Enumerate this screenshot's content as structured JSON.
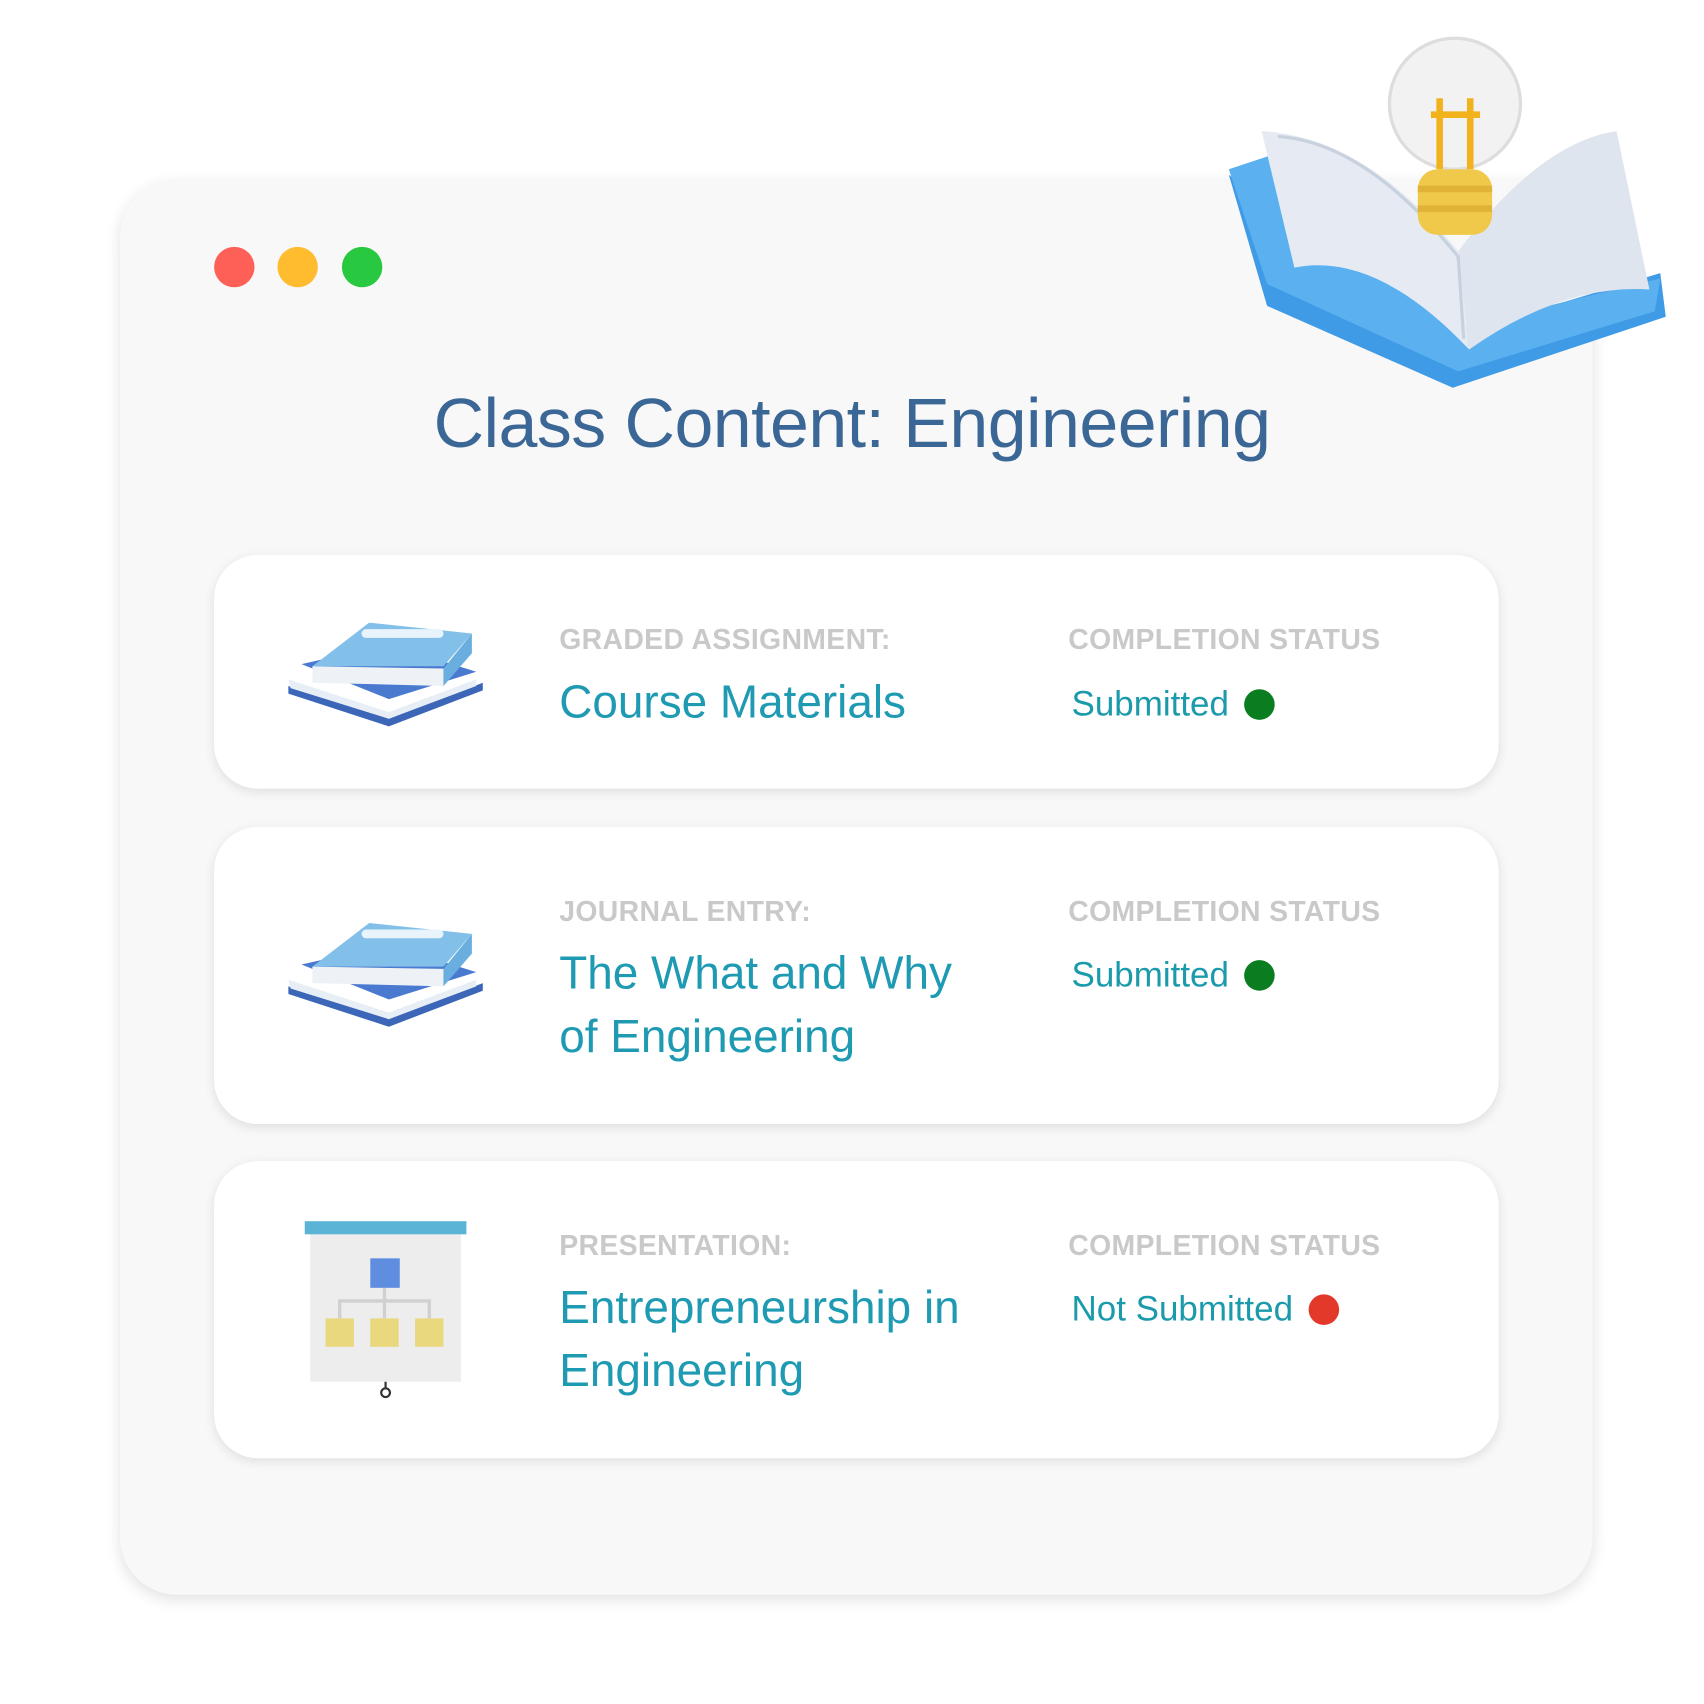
{
  "window": {
    "controls": {
      "close_color": "#fe5f57",
      "minimize_color": "#febc2e",
      "maximize_color": "#28c840"
    }
  },
  "header": {
    "title": "Class Content: Engineering",
    "decoration_icon": "open-book-lightbulb-icon"
  },
  "items": [
    {
      "type_label": "GRADED ASSIGNMENT:",
      "title": "Course Materials",
      "status_label": "COMPLETION STATUS",
      "status": "Submitted",
      "status_color": "#0a7d21",
      "icon": "books-icon"
    },
    {
      "type_label": "JOURNAL ENTRY:",
      "title": "The What and Why of Engineering",
      "status_label": "COMPLETION STATUS",
      "status": "Submitted",
      "status_color": "#0a7d21",
      "icon": "books-icon"
    },
    {
      "type_label": "PRESENTATION:",
      "title": "Entrepreneurship in Engineering",
      "status_label": "COMPLETION STATUS",
      "status": "Not Submitted",
      "status_color": "#e2392b",
      "icon": "presentation-board-icon"
    }
  ]
}
